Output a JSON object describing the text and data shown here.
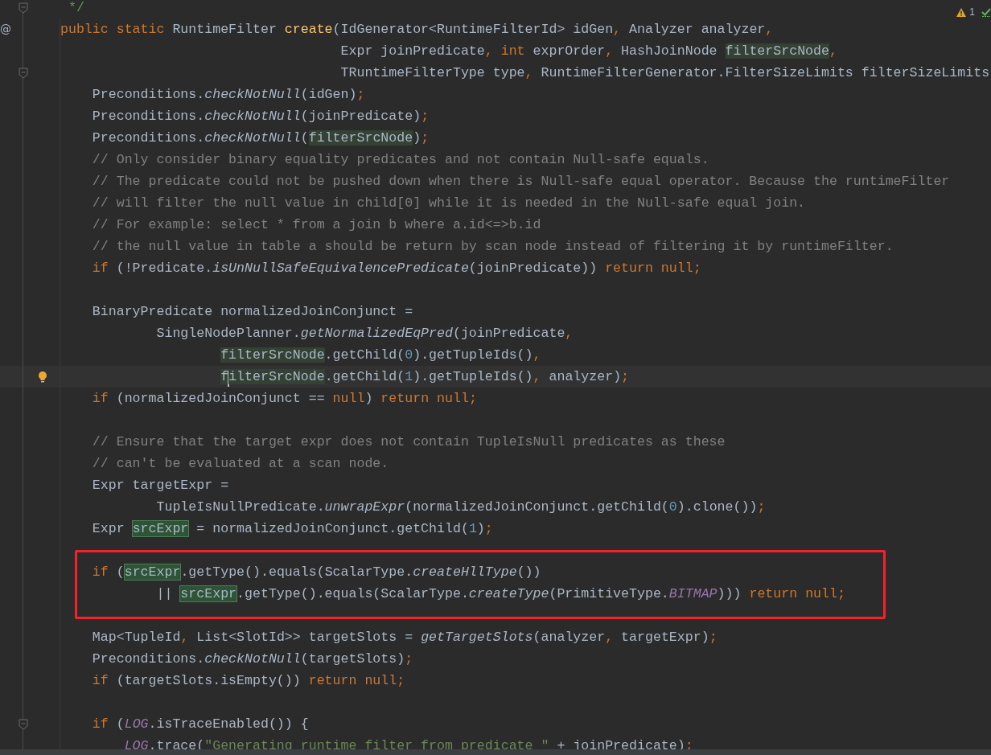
{
  "inspections": {
    "warnings": "1"
  },
  "lines": [
    {
      "kind": "doc",
      "fold": true,
      "tokens": [
        {
          "t": "*/",
          "kind": "doc"
        }
      ]
    },
    {
      "kind": "top",
      "gutter_mark": "@",
      "tokens": [
        {
          "t": "public static",
          "kind": "kw"
        },
        {
          "t": " RuntimeFilter ",
          "kind": "plain"
        },
        {
          "t": "create",
          "kind": "decl"
        },
        {
          "t": "(IdGenerator<RuntimeFilterId> idGen",
          "kind": "plain"
        },
        {
          "t": ", ",
          "kind": "punct"
        },
        {
          "t": "Analyzer analyzer",
          "kind": "plain"
        },
        {
          "t": ",",
          "kind": "punct"
        }
      ]
    },
    {
      "kind": "params",
      "tokens": [
        {
          "t": "Expr joinPredicate",
          "kind": "plain"
        },
        {
          "t": ", ",
          "kind": "punct"
        },
        {
          "t": "int",
          "kind": "kw"
        },
        {
          "t": " exprOrder",
          "kind": "plain"
        },
        {
          "t": ", ",
          "kind": "punct"
        },
        {
          "t": "HashJoinNode ",
          "kind": "plain"
        },
        {
          "t": "filterSrcNode",
          "kind": "usage"
        },
        {
          "t": ",",
          "kind": "punct"
        }
      ]
    },
    {
      "kind": "params",
      "fold": true,
      "tokens": [
        {
          "t": "TRuntimeFilterType type",
          "kind": "plain"
        },
        {
          "t": ", ",
          "kind": "punct"
        },
        {
          "t": "RuntimeFilterGenerator.FilterSizeLimits filterSizeLimits",
          "kind": "plain"
        }
      ]
    },
    {
      "kind": "body",
      "tokens": [
        {
          "t": "Preconditions.",
          "kind": "plain"
        },
        {
          "t": "checkNotNull",
          "kind": "static"
        },
        {
          "t": "(idGen)",
          "kind": "plain"
        },
        {
          "t": ";",
          "kind": "punct"
        }
      ]
    },
    {
      "kind": "body",
      "tokens": [
        {
          "t": "Preconditions.",
          "kind": "plain"
        },
        {
          "t": "checkNotNull",
          "kind": "static"
        },
        {
          "t": "(joinPredicate)",
          "kind": "plain"
        },
        {
          "t": ";",
          "kind": "punct"
        }
      ]
    },
    {
      "kind": "body",
      "tokens": [
        {
          "t": "Preconditions.",
          "kind": "plain"
        },
        {
          "t": "checkNotNull",
          "kind": "static"
        },
        {
          "t": "(",
          "kind": "plain"
        },
        {
          "t": "filterSrcNode",
          "kind": "usage"
        },
        {
          "t": ")",
          "kind": "plain"
        },
        {
          "t": ";",
          "kind": "punct"
        }
      ]
    },
    {
      "kind": "body",
      "tokens": [
        {
          "t": "// Only consider binary equality predicates and not contain Null-safe equals.",
          "kind": "comment"
        }
      ]
    },
    {
      "kind": "body",
      "tokens": [
        {
          "t": "// The predicate could not be pushed down when there is Null-safe equal operator. Because the runtimeFilter",
          "kind": "comment"
        }
      ]
    },
    {
      "kind": "body",
      "tokens": [
        {
          "t": "// will filter the null value in child[0] while it is needed in the Null-safe equal join.",
          "kind": "comment"
        }
      ]
    },
    {
      "kind": "body",
      "tokens": [
        {
          "t": "// For example: select * from a join b where a.id<=>b.id",
          "kind": "comment"
        }
      ]
    },
    {
      "kind": "body",
      "tokens": [
        {
          "t": "// the null value in table a should be return by scan node instead of filtering it by runtimeFilter.",
          "kind": "comment"
        }
      ]
    },
    {
      "kind": "body",
      "tokens": [
        {
          "t": "if",
          "kind": "kw"
        },
        {
          "t": " (!Predicate.",
          "kind": "plain"
        },
        {
          "t": "isUnNullSafeEquivalencePredicate",
          "kind": "static"
        },
        {
          "t": "(joinPredicate)) ",
          "kind": "plain"
        },
        {
          "t": "return null;",
          "kind": "kw"
        }
      ]
    },
    {
      "kind": "blank"
    },
    {
      "kind": "body",
      "tokens": [
        {
          "t": "BinaryPredicate normalizedJoinConjunct =",
          "kind": "plain"
        }
      ]
    },
    {
      "kind": "continuation",
      "tokens": [
        {
          "t": "SingleNodePlanner.",
          "kind": "plain"
        },
        {
          "t": "getNormalizedEqPred",
          "kind": "static"
        },
        {
          "t": "(joinPredicate",
          "kind": "plain"
        },
        {
          "t": ",",
          "kind": "punct"
        }
      ]
    },
    {
      "kind": "argument",
      "tokens": [
        {
          "t": "filterSrcNode",
          "kind": "usage"
        },
        {
          "t": ".getChild(",
          "kind": "plain"
        },
        {
          "t": "0",
          "kind": "num"
        },
        {
          "t": ").getTupleIds()",
          "kind": "plain"
        },
        {
          "t": ",",
          "kind": "punct"
        }
      ]
    },
    {
      "kind": "argument",
      "current": true,
      "tokens": [
        {
          "t": "f",
          "kind": "usage",
          "caret": true
        },
        {
          "t": "ilterSrcNode",
          "kind": "usage"
        },
        {
          "t": ".getChild(",
          "kind": "plain"
        },
        {
          "t": "1",
          "kind": "num"
        },
        {
          "t": ").getTupleIds()",
          "kind": "plain"
        },
        {
          "t": ", ",
          "kind": "punct"
        },
        {
          "t": "analyzer)",
          "kind": "plain"
        },
        {
          "t": ";",
          "kind": "punct"
        }
      ]
    },
    {
      "kind": "body",
      "tokens": [
        {
          "t": "if",
          "kind": "kw"
        },
        {
          "t": " (normalizedJoinConjunct == ",
          "kind": "plain"
        },
        {
          "t": "null",
          "kind": "kw"
        },
        {
          "t": ") ",
          "kind": "plain"
        },
        {
          "t": "return null;",
          "kind": "kw"
        }
      ]
    },
    {
      "kind": "blank"
    },
    {
      "kind": "body",
      "tokens": [
        {
          "t": "// Ensure that the target expr does not contain TupleIsNull predicates as these",
          "kind": "comment"
        }
      ]
    },
    {
      "kind": "body",
      "tokens": [
        {
          "t": "// can't be evaluated at a scan node.",
          "kind": "comment"
        }
      ]
    },
    {
      "kind": "body",
      "tokens": [
        {
          "t": "Expr targetExpr =",
          "kind": "plain"
        }
      ]
    },
    {
      "kind": "continuation",
      "tokens": [
        {
          "t": "TupleIsNullPredicate.",
          "kind": "plain"
        },
        {
          "t": "unwrapExpr",
          "kind": "static"
        },
        {
          "t": "(normalizedJoinConjunct.getChild(",
          "kind": "plain"
        },
        {
          "t": "0",
          "kind": "num"
        },
        {
          "t": ").clone())",
          "kind": "plain"
        },
        {
          "t": ";",
          "kind": "punct"
        }
      ]
    },
    {
      "kind": "body",
      "tokens": [
        {
          "t": "Expr ",
          "kind": "plain"
        },
        {
          "t": "srcExpr",
          "kind": "write"
        },
        {
          "t": " = normalizedJoinConjunct.getChild(",
          "kind": "plain"
        },
        {
          "t": "1",
          "kind": "num"
        },
        {
          "t": ")",
          "kind": "plain"
        },
        {
          "t": ";",
          "kind": "punct"
        }
      ]
    },
    {
      "kind": "blank"
    },
    {
      "kind": "body",
      "framed": true,
      "tokens": [
        {
          "t": "if",
          "kind": "kw"
        },
        {
          "t": " (",
          "kind": "plain"
        },
        {
          "t": "srcExpr",
          "kind": "write"
        },
        {
          "t": ".getType().equals(ScalarType.",
          "kind": "plain"
        },
        {
          "t": "createHllType",
          "kind": "static"
        },
        {
          "t": "())",
          "kind": "plain"
        }
      ]
    },
    {
      "kind": "continuation",
      "framed": true,
      "tokens": [
        {
          "t": "|| ",
          "kind": "plain"
        },
        {
          "t": "srcExpr",
          "kind": "write"
        },
        {
          "t": ".getType().equals(ScalarType.",
          "kind": "plain"
        },
        {
          "t": "createType",
          "kind": "static"
        },
        {
          "t": "(PrimitiveType.",
          "kind": "plain"
        },
        {
          "t": "BITMAP",
          "kind": "const"
        },
        {
          "t": "))) ",
          "kind": "plain"
        },
        {
          "t": "return null;",
          "kind": "kw"
        }
      ]
    },
    {
      "kind": "blank"
    },
    {
      "kind": "body",
      "tokens": [
        {
          "t": "Map<TupleId",
          "kind": "plain"
        },
        {
          "t": ", ",
          "kind": "punct"
        },
        {
          "t": "List<SlotId>> targetSlots = ",
          "kind": "plain"
        },
        {
          "t": "getTargetSlots",
          "kind": "static"
        },
        {
          "t": "(analyzer",
          "kind": "plain"
        },
        {
          "t": ", ",
          "kind": "punct"
        },
        {
          "t": "targetExpr)",
          "kind": "plain"
        },
        {
          "t": ";",
          "kind": "punct"
        }
      ]
    },
    {
      "kind": "body",
      "tokens": [
        {
          "t": "Preconditions.",
          "kind": "plain"
        },
        {
          "t": "checkNotNull",
          "kind": "static"
        },
        {
          "t": "(targetSlots)",
          "kind": "plain"
        },
        {
          "t": ";",
          "kind": "punct"
        }
      ]
    },
    {
      "kind": "body",
      "tokens": [
        {
          "t": "if",
          "kind": "kw"
        },
        {
          "t": " (targetSlots.isEmpty()) ",
          "kind": "plain"
        },
        {
          "t": "return null;",
          "kind": "kw"
        }
      ]
    },
    {
      "kind": "blank"
    },
    {
      "kind": "body",
      "fold": true,
      "tokens": [
        {
          "t": "if",
          "kind": "kw"
        },
        {
          "t": " (",
          "kind": "plain"
        },
        {
          "t": "LOG",
          "kind": "const"
        },
        {
          "t": ".isTraceEnabled()) {",
          "kind": "plain"
        }
      ]
    },
    {
      "kind": "nested",
      "tokens": [
        {
          "t": "LOG",
          "kind": "const"
        },
        {
          "t": ".trace(",
          "kind": "plain"
        },
        {
          "t": "\"Generating runtime filter from predicate \"",
          "kind": "string"
        },
        {
          "t": " + joinPredicate)",
          "kind": "plain"
        },
        {
          "t": ";",
          "kind": "punct"
        }
      ]
    }
  ]
}
